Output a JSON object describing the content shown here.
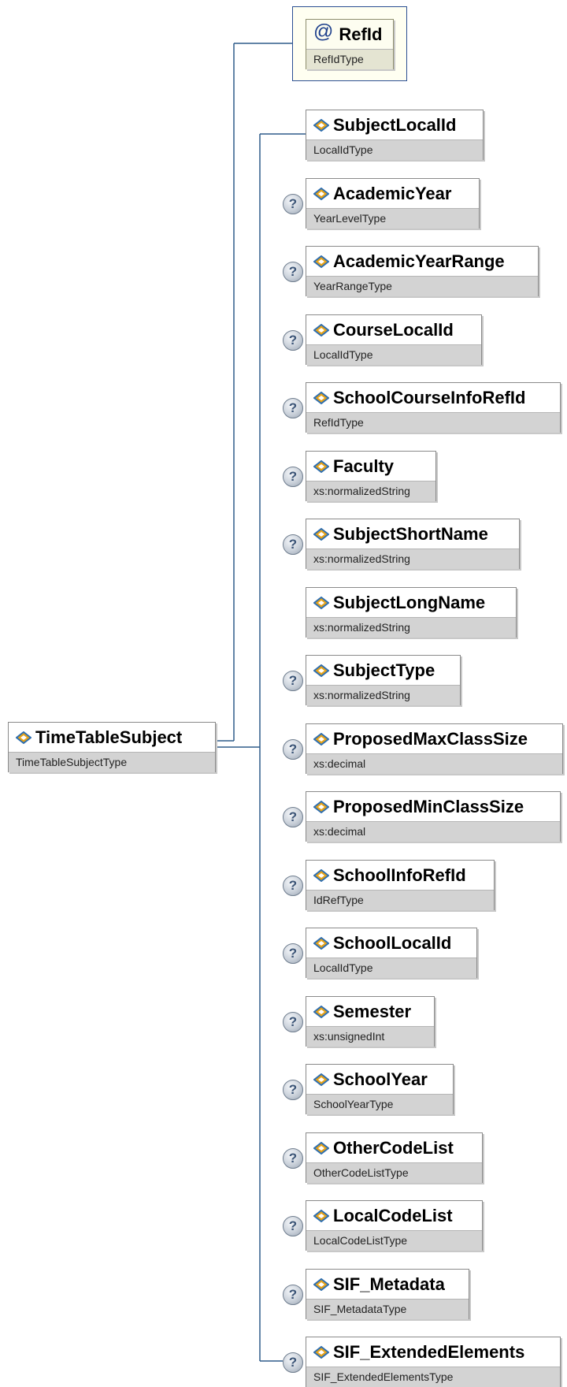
{
  "root": {
    "name": "TimeTableSubject",
    "type": "TimeTableSubjectType"
  },
  "attributes": [
    {
      "name": "RefId",
      "type": "RefIdType"
    }
  ],
  "elements": [
    {
      "name": "SubjectLocalId",
      "type": "LocalIdType",
      "optional": false
    },
    {
      "name": "AcademicYear",
      "type": "YearLevelType",
      "optional": true
    },
    {
      "name": "AcademicYearRange",
      "type": "YearRangeType",
      "optional": true
    },
    {
      "name": "CourseLocalId",
      "type": "LocalIdType",
      "optional": true
    },
    {
      "name": "SchoolCourseInfoRefId",
      "type": "RefIdType",
      "optional": true
    },
    {
      "name": "Faculty",
      "type": "xs:normalizedString",
      "optional": true
    },
    {
      "name": "SubjectShortName",
      "type": "xs:normalizedString",
      "optional": true
    },
    {
      "name": "SubjectLongName",
      "type": "xs:normalizedString",
      "optional": false
    },
    {
      "name": "SubjectType",
      "type": "xs:normalizedString",
      "optional": true
    },
    {
      "name": "ProposedMaxClassSize",
      "type": "xs:decimal",
      "optional": true
    },
    {
      "name": "ProposedMinClassSize",
      "type": "xs:decimal",
      "optional": true
    },
    {
      "name": "SchoolInfoRefId",
      "type": "IdRefType",
      "optional": true
    },
    {
      "name": "SchoolLocalId",
      "type": "LocalIdType",
      "optional": true
    },
    {
      "name": "Semester",
      "type": "xs:unsignedInt",
      "optional": true
    },
    {
      "name": "SchoolYear",
      "type": "SchoolYearType",
      "optional": true
    },
    {
      "name": "OtherCodeList",
      "type": "OtherCodeListType",
      "optional": true
    },
    {
      "name": "LocalCodeList",
      "type": "LocalCodeListType",
      "optional": true
    },
    {
      "name": "SIF_Metadata",
      "type": "SIF_MetadataType",
      "optional": true
    },
    {
      "name": "SIF_ExtendedElements",
      "type": "SIF_ExtendedElementsType",
      "optional": true
    }
  ],
  "icons": {
    "element": "element-diamond-icon",
    "attribute": "at-sign-icon",
    "optional": "question-mark-icon"
  },
  "colors": {
    "connector": "#2e5c8a",
    "attribute_frame": "#2b4f93",
    "element_icon": "#e8a317"
  }
}
